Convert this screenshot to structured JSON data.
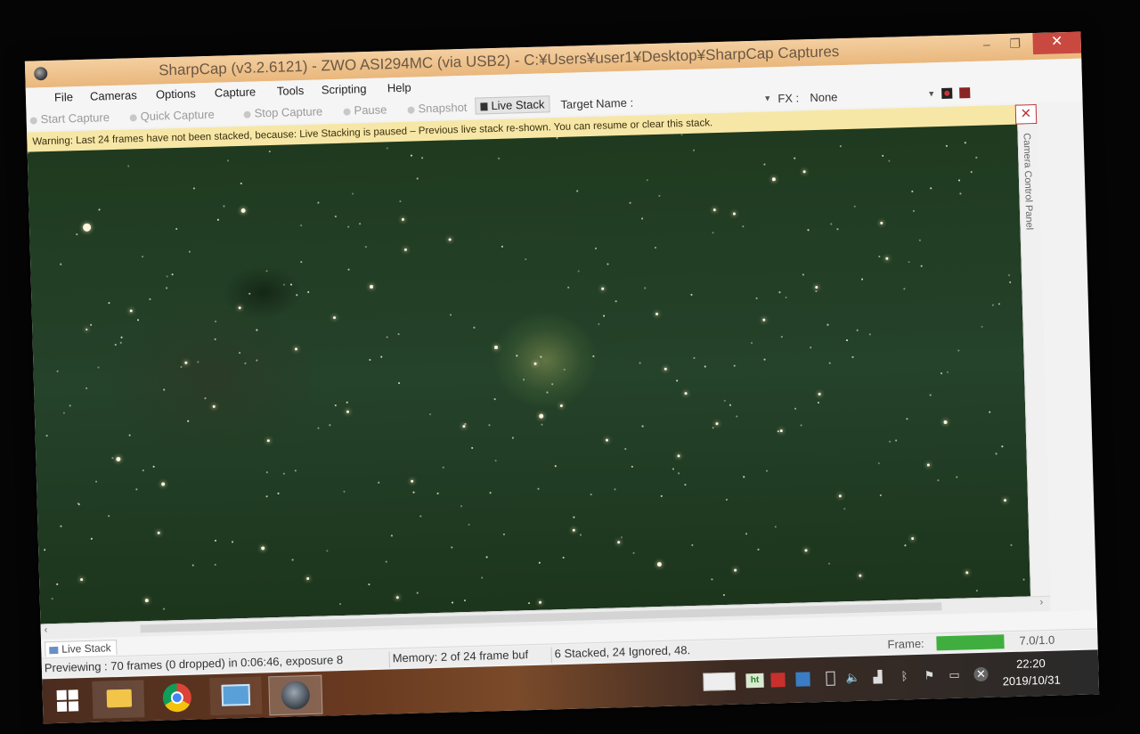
{
  "window": {
    "title": "SharpCap (v3.2.6121) - ZWO ASI294MC (via USB2) - C:¥Users¥user1¥Desktop¥SharpCap Captures",
    "minimize": "–",
    "maximize": "❐",
    "close": "✕"
  },
  "menu": {
    "items": [
      "File",
      "Cameras",
      "Options",
      "Capture",
      "Tools",
      "Scripting",
      "Help"
    ]
  },
  "toolbar": {
    "start_capture": "Start Capture",
    "quick_capture": "Quick Capture",
    "stop_capture": "Stop Capture",
    "pause": "Pause",
    "snapshot": "Snapshot",
    "live_stack": "Live Stack",
    "target_name_label": "Target Name :",
    "fx_label": "FX :",
    "fx_value": "None"
  },
  "warning": {
    "text": "Warning: Last 24 frames have not been stacked, because: Live Stacking is paused – Previous live stack re-shown. You can resume or clear this stack.",
    "close": "✕"
  },
  "side_panel": {
    "label": "Camera Control Panel"
  },
  "tabs": {
    "live_stack": "Live Stack"
  },
  "status": {
    "preview": "Previewing : 70 frames (0 dropped) in 0:06:46, exposure 8",
    "memory": "Memory: 2 of 24 frame buf",
    "stacked": "6 Stacked, 24 Ignored, 48.",
    "frame_label": "Frame:",
    "frame_value": "7.0/1.0",
    "frame_bar_color": "#3fae3f"
  },
  "taskbar": {
    "clock_time": "22:20",
    "clock_date": "2019/10/31",
    "ht_label": "ht"
  }
}
